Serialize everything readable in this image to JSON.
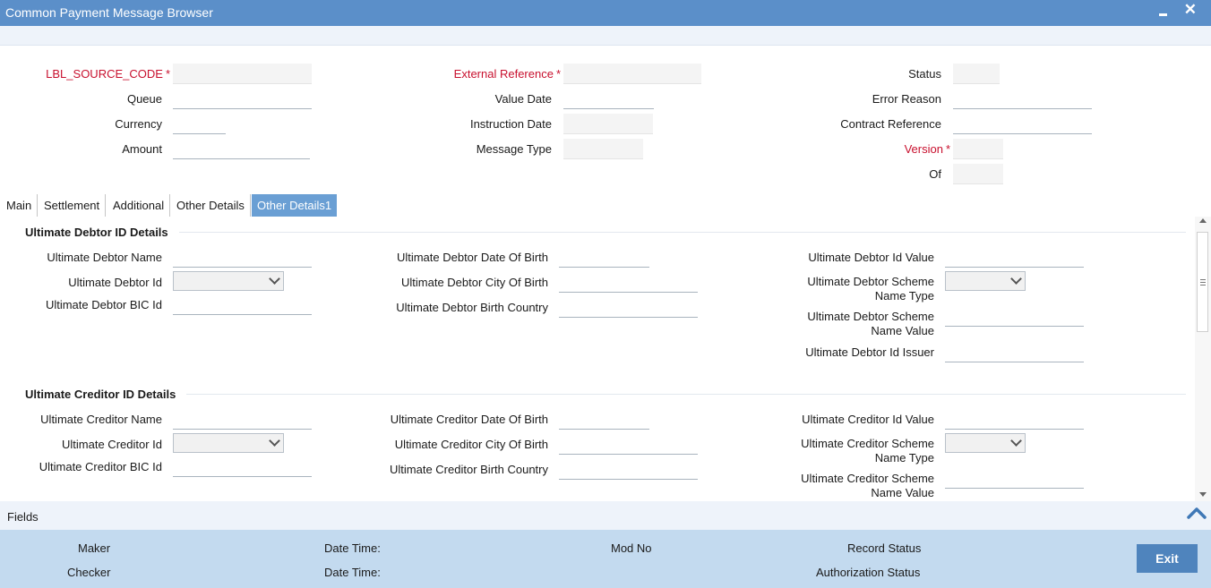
{
  "window": {
    "title": "Common Payment Message Browser"
  },
  "header": {
    "source_code_label": "LBL_SOURCE_CODE",
    "queue_label": "Queue",
    "currency_label": "Currency",
    "amount_label": "Amount",
    "external_reference_label": "External Reference",
    "value_date_label": "Value Date",
    "instruction_date_label": "Instruction Date",
    "message_type_label": "Message Type",
    "status_label": "Status",
    "error_reason_label": "Error Reason",
    "contract_reference_label": "Contract Reference",
    "version_label": "Version",
    "of_label": "Of",
    "required_marker": "*"
  },
  "tabs": [
    {
      "label": "Main",
      "active": false
    },
    {
      "label": "Settlement",
      "active": false
    },
    {
      "label": "Additional",
      "active": false
    },
    {
      "label": "Other Details",
      "active": false
    },
    {
      "label": "Other Details1",
      "active": true
    }
  ],
  "debtor": {
    "section_title": "Ultimate Debtor ID Details",
    "name_label": "Ultimate Debtor Name",
    "id_label": "Ultimate Debtor Id",
    "bic_label": "Ultimate Debtor BIC Id",
    "dob_label": "Ultimate Debtor Date Of Birth",
    "city_label": "Ultimate Debtor City Of Birth",
    "country_label": "Ultimate Debtor Birth Country",
    "id_value_label": "Ultimate Debtor Id Value",
    "scheme_type_label_1": "Ultimate Debtor Scheme",
    "scheme_type_label_2": "Name Type",
    "scheme_value_label_1": "Ultimate Debtor Scheme",
    "scheme_value_label_2": "Name Value",
    "issuer_label": "Ultimate Debtor Id Issuer"
  },
  "creditor": {
    "section_title": "Ultimate Creditor ID Details",
    "name_label": "Ultimate Creditor Name",
    "id_label": "Ultimate Creditor Id",
    "bic_label": "Ultimate Creditor BIC Id",
    "dob_label": "Ultimate Creditor Date Of Birth",
    "city_label": "Ultimate Creditor City Of Birth",
    "country_label": "Ultimate Creditor Birth Country",
    "id_value_label": "Ultimate Creditor Id Value",
    "scheme_type_label_1": "Ultimate Creditor Scheme",
    "scheme_type_label_2": "Name Type",
    "scheme_value_label_1": "Ultimate Creditor Scheme",
    "scheme_value_label_2": "Name Value"
  },
  "fields_bar": {
    "label": "Fields"
  },
  "footer": {
    "maker_label": "Maker",
    "checker_label": "Checker",
    "date_time_label": "Date Time:",
    "mod_no_label": "Mod No",
    "record_status_label": "Record Status",
    "authorization_status_label": "Authorization Status",
    "exit_label": "Exit"
  },
  "colors": {
    "title_bar": "#5b8fc9",
    "required_text": "#c8102e",
    "active_tab": "#6a9fd4",
    "footer_bg": "#c3daef",
    "exit_button": "#4f84bd"
  }
}
